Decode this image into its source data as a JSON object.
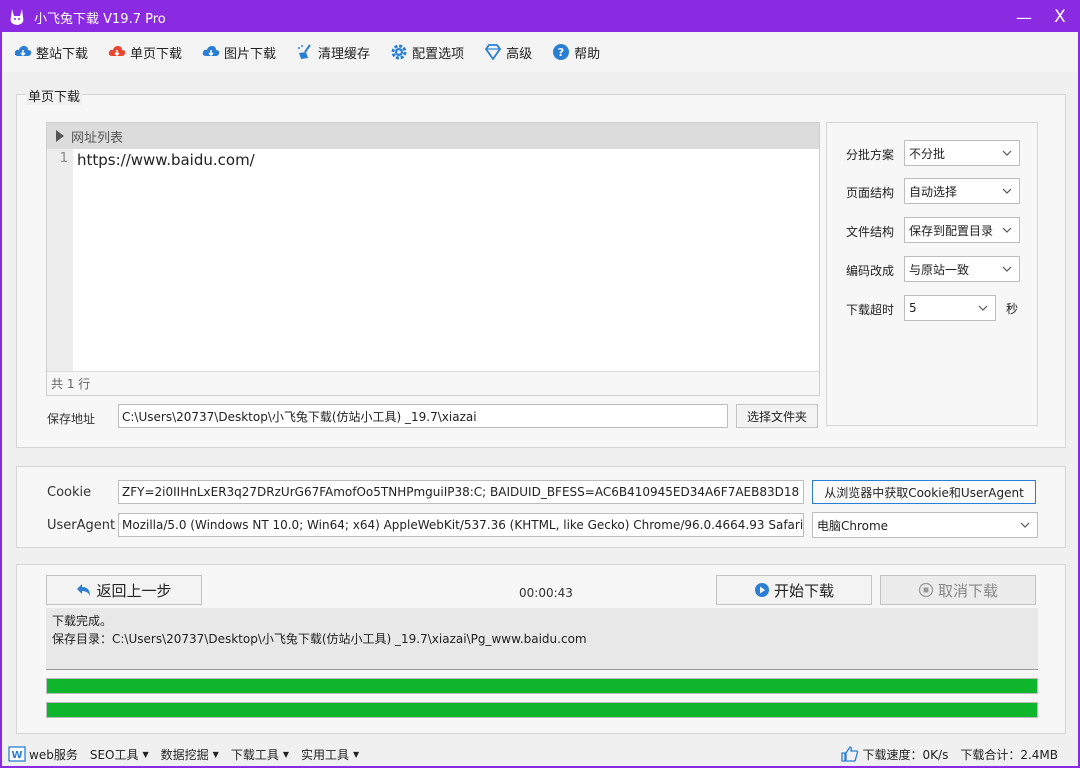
{
  "window": {
    "title": "小飞兔下载 V19.7 Pro",
    "minimize": "—",
    "close": "X"
  },
  "colors": {
    "title_bar": "#8a2be2",
    "progress_fill": "#10b52e",
    "accent_blue": "#2a7fd4"
  },
  "toolbar": {
    "items": [
      {
        "label": "整站下载",
        "icon": "cloud-download-icon"
      },
      {
        "label": "单页下载",
        "icon": "cloud-download-red-icon"
      },
      {
        "label": "图片下载",
        "icon": "cloud-download-icon"
      },
      {
        "label": "清理缓存",
        "icon": "broom-icon"
      },
      {
        "label": "配置选项",
        "icon": "gear-icon"
      },
      {
        "label": "高级",
        "icon": "diamond-icon"
      },
      {
        "label": "帮助",
        "icon": "help-icon"
      }
    ]
  },
  "single_page": {
    "group_title": "单页下载",
    "url_list": {
      "header": "网址列表",
      "line_numbers": [
        "1"
      ],
      "lines": [
        "https://www.baidu.com/"
      ],
      "footer": "共 1 行"
    },
    "save_label": "保存地址",
    "save_path": "C:\\Users\\20737\\Desktop\\小飞兔下载(仿站小工具) _19.7\\xiazai",
    "choose_folder": "选择文件夹",
    "options": [
      {
        "label": "分批方案",
        "value": "不分批"
      },
      {
        "label": "页面结构",
        "value": "自动选择"
      },
      {
        "label": "文件结构",
        "value": "保存到配置目录"
      },
      {
        "label": "编码改成",
        "value": "与原站一致"
      },
      {
        "label": "下载超时",
        "value": "5",
        "unit": "秒"
      }
    ]
  },
  "request": {
    "cookie_label": "Cookie",
    "cookie_value": "ZFY=2i0IIHnLxER3q27DRzUrG67FAmofOo5TNHPmguiIP38:C; BAIDUID_BFESS=AC6B410945ED34A6F7AEB83D18",
    "get_cookie_button": "从浏览器中获取Cookie和UserAgent",
    "ua_label": "UserAgent",
    "ua_value": "Mozilla/5.0 (Windows NT 10.0; Win64; x64) AppleWebKit/537.36 (KHTML, like Gecko) Chrome/96.0.4664.93 Safari",
    "ua_select": "电脑Chrome"
  },
  "actions": {
    "back": "返回上一步",
    "timer": "00:00:43",
    "start": "开始下载",
    "cancel": "取消下载"
  },
  "log": {
    "line1": "下载完成。",
    "line2": "保存目录：C:\\Users\\20737\\Desktop\\小飞兔下载(仿站小工具) _19.7\\xiazai\\Pg_www.baidu.com"
  },
  "progress": {
    "bar1_percent": 100,
    "bar2_percent": 100
  },
  "statusbar": {
    "menus": [
      {
        "label": "web服务",
        "icon": "web-icon",
        "caret": false
      },
      {
        "label": "SEO工具",
        "caret": true
      },
      {
        "label": "数据挖掘",
        "caret": true
      },
      {
        "label": "下载工具",
        "caret": true
      },
      {
        "label": "实用工具",
        "caret": true
      }
    ],
    "speed": "下载速度：0K/s",
    "total": "下载合计：2.4MB"
  }
}
